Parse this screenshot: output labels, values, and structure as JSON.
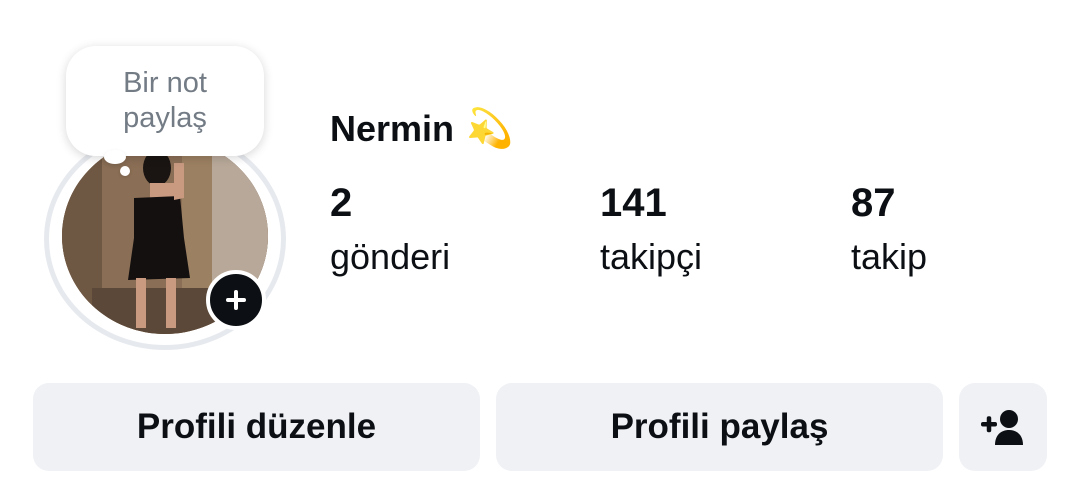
{
  "note": {
    "text": "Bir not paylaş"
  },
  "profile": {
    "name": "Nermin",
    "name_emoji": "💫"
  },
  "stats": {
    "posts": {
      "value": "2",
      "label": "gönderi"
    },
    "followers": {
      "value": "141",
      "label": "takipçi"
    },
    "following": {
      "value": "87",
      "label": "takip"
    }
  },
  "actions": {
    "edit_label": "Profili düzenle",
    "share_label": "Profili paylaş",
    "add_friend_icon": "person-add-icon"
  },
  "icons": {
    "add_story": "plus-icon"
  },
  "colors": {
    "text": "#0c1014",
    "note_text": "#737b85",
    "button_bg": "#eff1f5",
    "ring": "#e6e9ee"
  }
}
